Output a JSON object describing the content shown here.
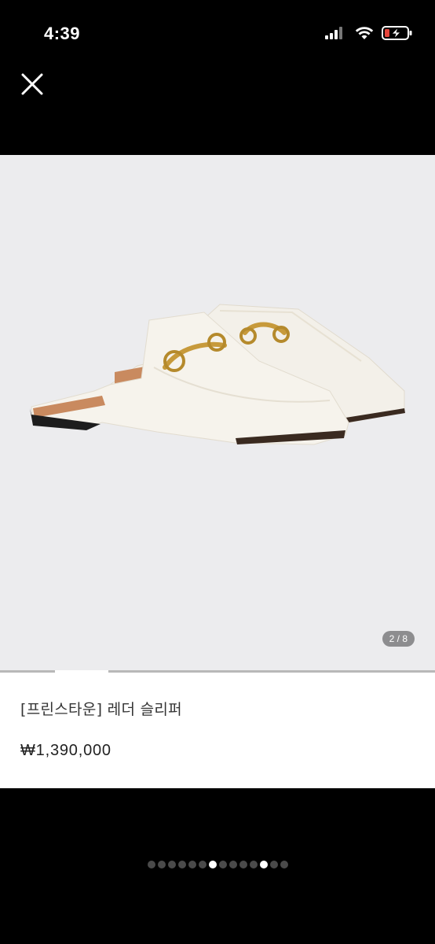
{
  "status": {
    "time": "4:39"
  },
  "gallery": {
    "indicator": "2 / 8"
  },
  "product": {
    "title": "[프린스타운] 레더 슬리퍼",
    "price": "₩1,390,000"
  },
  "pager": {
    "count": 14,
    "active": [
      6,
      11
    ]
  },
  "colors": {
    "background": "#000000",
    "image_bg": "#ececee",
    "panel": "#ffffff"
  }
}
